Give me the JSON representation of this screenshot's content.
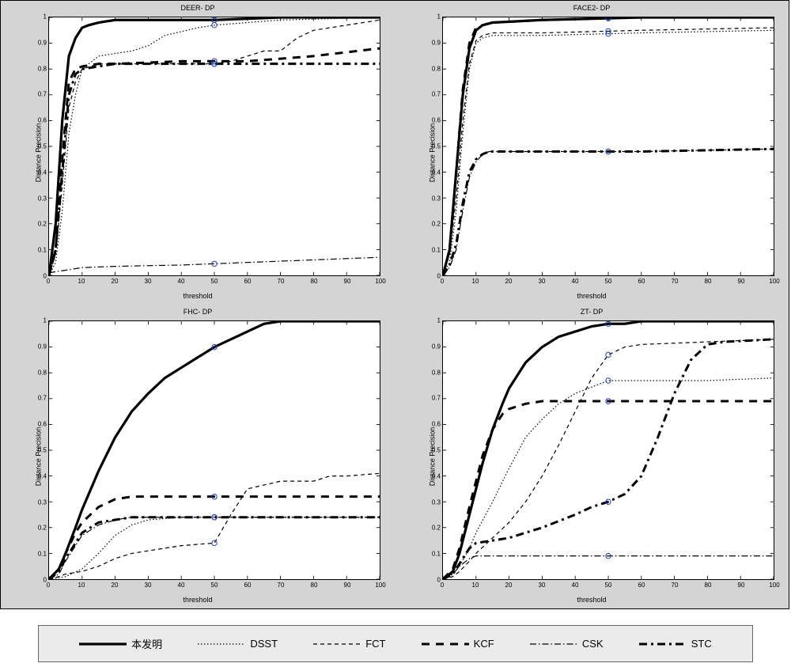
{
  "chart_data": [
    {
      "id": "deer",
      "type": "line",
      "title": "DEER- DP",
      "xlabel": "threshold",
      "ylabel": "Distance Precision",
      "xlim": [
        0,
        100
      ],
      "ylim": [
        0,
        1
      ],
      "series": [
        {
          "name": "本发明",
          "style": "solid_thick",
          "marker_at": 50,
          "x": [
            0,
            2,
            4,
            6,
            8,
            10,
            12,
            15,
            20,
            30,
            50,
            70,
            100
          ],
          "y": [
            0,
            0.2,
            0.6,
            0.85,
            0.92,
            0.96,
            0.97,
            0.98,
            0.99,
            0.99,
            0.99,
            1.0,
            1.0
          ]
        },
        {
          "name": "DSST",
          "style": "dotted",
          "marker_at": 50,
          "x": [
            0,
            2,
            4,
            6,
            8,
            10,
            15,
            20,
            25,
            30,
            35,
            45,
            50,
            60,
            70,
            100
          ],
          "y": [
            0,
            0.05,
            0.25,
            0.55,
            0.7,
            0.8,
            0.85,
            0.86,
            0.87,
            0.89,
            0.93,
            0.96,
            0.97,
            0.98,
            0.99,
            1.0
          ]
        },
        {
          "name": "FCT",
          "style": "short_dash",
          "marker_at": 50,
          "x": [
            0,
            2,
            4,
            6,
            8,
            10,
            15,
            20,
            30,
            50,
            55,
            60,
            65,
            70,
            75,
            80,
            100
          ],
          "y": [
            0,
            0.08,
            0.35,
            0.65,
            0.75,
            0.8,
            0.82,
            0.82,
            0.82,
            0.82,
            0.83,
            0.85,
            0.87,
            0.87,
            0.92,
            0.95,
            0.99
          ]
        },
        {
          "name": "KCF",
          "style": "thick_dash",
          "marker_at": 50,
          "x": [
            0,
            2,
            4,
            6,
            8,
            10,
            15,
            20,
            40,
            60,
            80,
            100
          ],
          "y": [
            0,
            0.1,
            0.45,
            0.75,
            0.8,
            0.81,
            0.82,
            0.82,
            0.83,
            0.83,
            0.85,
            0.88
          ]
        },
        {
          "name": "CSK",
          "style": "dashdot",
          "marker_at": 50,
          "x": [
            0,
            5,
            10,
            20,
            40,
            50,
            60,
            80,
            100
          ],
          "y": [
            0.01,
            0.02,
            0.03,
            0.035,
            0.04,
            0.045,
            0.05,
            0.06,
            0.07
          ]
        },
        {
          "name": "STC",
          "style": "thick_dashdot",
          "marker_at": 50,
          "x": [
            0,
            2,
            4,
            6,
            8,
            10,
            15,
            20,
            40,
            60,
            80,
            100
          ],
          "y": [
            0,
            0.1,
            0.4,
            0.7,
            0.78,
            0.8,
            0.81,
            0.82,
            0.82,
            0.82,
            0.82,
            0.82
          ]
        }
      ]
    },
    {
      "id": "face2",
      "type": "line",
      "title": "FACE2- DP",
      "xlabel": "threshold",
      "ylabel": "Distance Precision",
      "xlim": [
        0,
        100
      ],
      "ylim": [
        0,
        1
      ],
      "series": [
        {
          "name": "本发明",
          "style": "solid_thick",
          "marker_at": 50,
          "x": [
            0,
            2,
            4,
            6,
            8,
            10,
            12,
            15,
            30,
            60,
            100
          ],
          "y": [
            0,
            0.1,
            0.4,
            0.7,
            0.88,
            0.95,
            0.97,
            0.98,
            0.99,
            1.0,
            1.0
          ]
        },
        {
          "name": "DSST",
          "style": "dotted",
          "marker_at": 50,
          "x": [
            0,
            2,
            4,
            6,
            8,
            10,
            12,
            15,
            30,
            60,
            100
          ],
          "y": [
            0,
            0.05,
            0.25,
            0.55,
            0.8,
            0.9,
            0.92,
            0.93,
            0.93,
            0.94,
            0.95
          ]
        },
        {
          "name": "FCT",
          "style": "short_dash",
          "marker_at": 50,
          "x": [
            0,
            2,
            4,
            6,
            8,
            10,
            12,
            15,
            30,
            60,
            100
          ],
          "y": [
            0,
            0.08,
            0.3,
            0.6,
            0.82,
            0.91,
            0.93,
            0.94,
            0.94,
            0.95,
            0.96
          ]
        },
        {
          "name": "KCF",
          "style": "thick_dash",
          "marker_at": 50,
          "x": [
            0,
            2,
            4,
            6,
            8,
            10,
            12,
            15,
            30,
            60,
            100
          ],
          "y": [
            0,
            0.1,
            0.4,
            0.72,
            0.9,
            0.96,
            0.97,
            0.98,
            0.99,
            1.0,
            1.0
          ]
        },
        {
          "name": "CSK",
          "style": "dashdot",
          "marker_at": 50,
          "x": [
            0,
            2,
            4,
            6,
            8,
            10,
            12,
            14,
            16,
            30,
            60,
            100
          ],
          "y": [
            0,
            0.03,
            0.1,
            0.25,
            0.38,
            0.44,
            0.47,
            0.48,
            0.48,
            0.48,
            0.48,
            0.49
          ]
        },
        {
          "name": "STC",
          "style": "thick_dashdot",
          "marker_at": 50,
          "x": [
            0,
            2,
            4,
            6,
            8,
            10,
            12,
            14,
            16,
            30,
            60,
            100
          ],
          "y": [
            0,
            0.04,
            0.12,
            0.28,
            0.4,
            0.45,
            0.47,
            0.48,
            0.48,
            0.48,
            0.48,
            0.49
          ]
        }
      ]
    },
    {
      "id": "fhc",
      "type": "line",
      "title": "FHC- DP",
      "xlabel": "threshold",
      "ylabel": "Distance Precision",
      "xlim": [
        0,
        100
      ],
      "ylim": [
        0,
        1
      ],
      "series": [
        {
          "name": "本发明",
          "style": "solid_thick",
          "marker_at": 50,
          "x": [
            0,
            3,
            5,
            8,
            10,
            15,
            20,
            25,
            30,
            35,
            40,
            45,
            50,
            55,
            60,
            65,
            70,
            100
          ],
          "y": [
            0,
            0.04,
            0.1,
            0.2,
            0.27,
            0.42,
            0.55,
            0.65,
            0.72,
            0.78,
            0.82,
            0.86,
            0.9,
            0.93,
            0.96,
            0.99,
            1.0,
            1.0
          ]
        },
        {
          "name": "DSST",
          "style": "dotted",
          "marker_at": 50,
          "x": [
            0,
            5,
            10,
            15,
            20,
            25,
            30,
            40,
            50,
            60,
            80,
            100
          ],
          "y": [
            0,
            0.01,
            0.04,
            0.1,
            0.17,
            0.21,
            0.23,
            0.24,
            0.24,
            0.24,
            0.24,
            0.24
          ]
        },
        {
          "name": "FCT",
          "style": "short_dash",
          "marker_at": 50,
          "x": [
            0,
            3,
            5,
            10,
            15,
            20,
            25,
            30,
            35,
            40,
            50,
            55,
            60,
            70,
            80,
            85,
            90,
            100
          ],
          "y": [
            0,
            0.01,
            0.02,
            0.03,
            0.05,
            0.08,
            0.1,
            0.11,
            0.12,
            0.13,
            0.14,
            0.25,
            0.35,
            0.38,
            0.38,
            0.4,
            0.4,
            0.41
          ]
        },
        {
          "name": "KCF",
          "style": "thick_dash",
          "marker_at": 50,
          "x": [
            0,
            3,
            5,
            8,
            10,
            15,
            20,
            25,
            30,
            50,
            70,
            100
          ],
          "y": [
            0,
            0.04,
            0.1,
            0.18,
            0.22,
            0.28,
            0.31,
            0.32,
            0.32,
            0.32,
            0.32,
            0.32
          ]
        },
        {
          "name": "CSK",
          "style": "dashdot",
          "marker_at": 50,
          "x": [
            0,
            3,
            5,
            8,
            10,
            15,
            20,
            25,
            30,
            50,
            70,
            100
          ],
          "y": [
            0,
            0.02,
            0.07,
            0.13,
            0.17,
            0.21,
            0.23,
            0.24,
            0.24,
            0.24,
            0.24,
            0.24
          ]
        },
        {
          "name": "STC",
          "style": "thick_dashdot",
          "marker_at": 50,
          "x": [
            0,
            3,
            5,
            8,
            10,
            15,
            20,
            25,
            30,
            50,
            70,
            100
          ],
          "y": [
            0,
            0.03,
            0.08,
            0.14,
            0.18,
            0.22,
            0.23,
            0.24,
            0.24,
            0.24,
            0.24,
            0.24
          ]
        }
      ]
    },
    {
      "id": "zt",
      "type": "line",
      "title": "ZT- DP",
      "xlabel": "threshold",
      "ylabel": "Distance Precision",
      "xlim": [
        0,
        100
      ],
      "ylim": [
        0,
        1
      ],
      "series": [
        {
          "name": "本发明",
          "style": "solid_thick",
          "marker_at": 50,
          "x": [
            0,
            3,
            5,
            8,
            10,
            12,
            15,
            18,
            20,
            25,
            30,
            35,
            40,
            45,
            50,
            55,
            60,
            100
          ],
          "y": [
            0,
            0.03,
            0.1,
            0.25,
            0.35,
            0.45,
            0.58,
            0.68,
            0.74,
            0.84,
            0.9,
            0.94,
            0.96,
            0.98,
            0.99,
            0.99,
            1.0,
            1.0
          ]
        },
        {
          "name": "DSST",
          "style": "dotted",
          "marker_at": 50,
          "x": [
            0,
            3,
            5,
            8,
            10,
            15,
            20,
            25,
            30,
            35,
            40,
            50,
            60,
            80,
            100
          ],
          "y": [
            0,
            0.02,
            0.05,
            0.12,
            0.18,
            0.3,
            0.43,
            0.55,
            0.62,
            0.68,
            0.72,
            0.77,
            0.77,
            0.77,
            0.78
          ]
        },
        {
          "name": "FCT",
          "style": "short_dash",
          "marker_at": 50,
          "x": [
            0,
            3,
            5,
            8,
            10,
            15,
            20,
            25,
            30,
            35,
            40,
            45,
            50,
            55,
            60,
            80,
            100
          ],
          "y": [
            0,
            0.01,
            0.03,
            0.07,
            0.1,
            0.16,
            0.22,
            0.3,
            0.4,
            0.52,
            0.65,
            0.78,
            0.87,
            0.9,
            0.91,
            0.92,
            0.93
          ]
        },
        {
          "name": "KCF",
          "style": "thick_dash",
          "marker_at": 50,
          "x": [
            0,
            3,
            5,
            8,
            10,
            12,
            15,
            18,
            20,
            25,
            30,
            40,
            60,
            100
          ],
          "y": [
            0,
            0.04,
            0.12,
            0.28,
            0.38,
            0.48,
            0.58,
            0.64,
            0.66,
            0.68,
            0.69,
            0.69,
            0.69,
            0.69
          ]
        },
        {
          "name": "CSK",
          "style": "dashdot",
          "marker_at": 50,
          "x": [
            0,
            3,
            5,
            8,
            10,
            15,
            100
          ],
          "y": [
            0,
            0.02,
            0.05,
            0.08,
            0.09,
            0.09,
            0.09
          ]
        },
        {
          "name": "STC",
          "style": "thick_dashdot",
          "marker_at": 50,
          "x": [
            0,
            3,
            5,
            8,
            10,
            15,
            20,
            30,
            40,
            45,
            50,
            55,
            60,
            65,
            70,
            75,
            80,
            85,
            100
          ],
          "y": [
            0,
            0.02,
            0.06,
            0.12,
            0.14,
            0.15,
            0.16,
            0.2,
            0.25,
            0.28,
            0.3,
            0.33,
            0.4,
            0.55,
            0.72,
            0.85,
            0.91,
            0.92,
            0.93
          ]
        }
      ]
    }
  ],
  "xticks": [
    0,
    10,
    20,
    30,
    40,
    50,
    60,
    70,
    80,
    90,
    100
  ],
  "yticks": [
    0,
    0.1,
    0.2,
    0.3,
    0.4,
    0.5,
    0.6,
    0.7,
    0.8,
    0.9,
    1
  ],
  "legend": [
    {
      "label": "本发明",
      "style": "solid_thick"
    },
    {
      "label": "DSST",
      "style": "dotted"
    },
    {
      "label": "FCT",
      "style": "short_dash"
    },
    {
      "label": "KCF",
      "style": "thick_dash"
    },
    {
      "label": "CSK",
      "style": "dashdot"
    },
    {
      "label": "STC",
      "style": "thick_dashdot"
    }
  ],
  "styles": {
    "solid_thick": {
      "stroke": "#000",
      "width": 3.2,
      "dash": ""
    },
    "dotted": {
      "stroke": "#000",
      "width": 1.2,
      "dash": "1.5 2.5"
    },
    "short_dash": {
      "stroke": "#000",
      "width": 1.2,
      "dash": "5 4"
    },
    "thick_dash": {
      "stroke": "#000",
      "width": 3.0,
      "dash": "10 8"
    },
    "dashdot": {
      "stroke": "#000",
      "width": 1.2,
      "dash": "8 3 1.5 3"
    },
    "thick_dashdot": {
      "stroke": "#000",
      "width": 3.0,
      "dash": "10 5 3 5"
    }
  }
}
